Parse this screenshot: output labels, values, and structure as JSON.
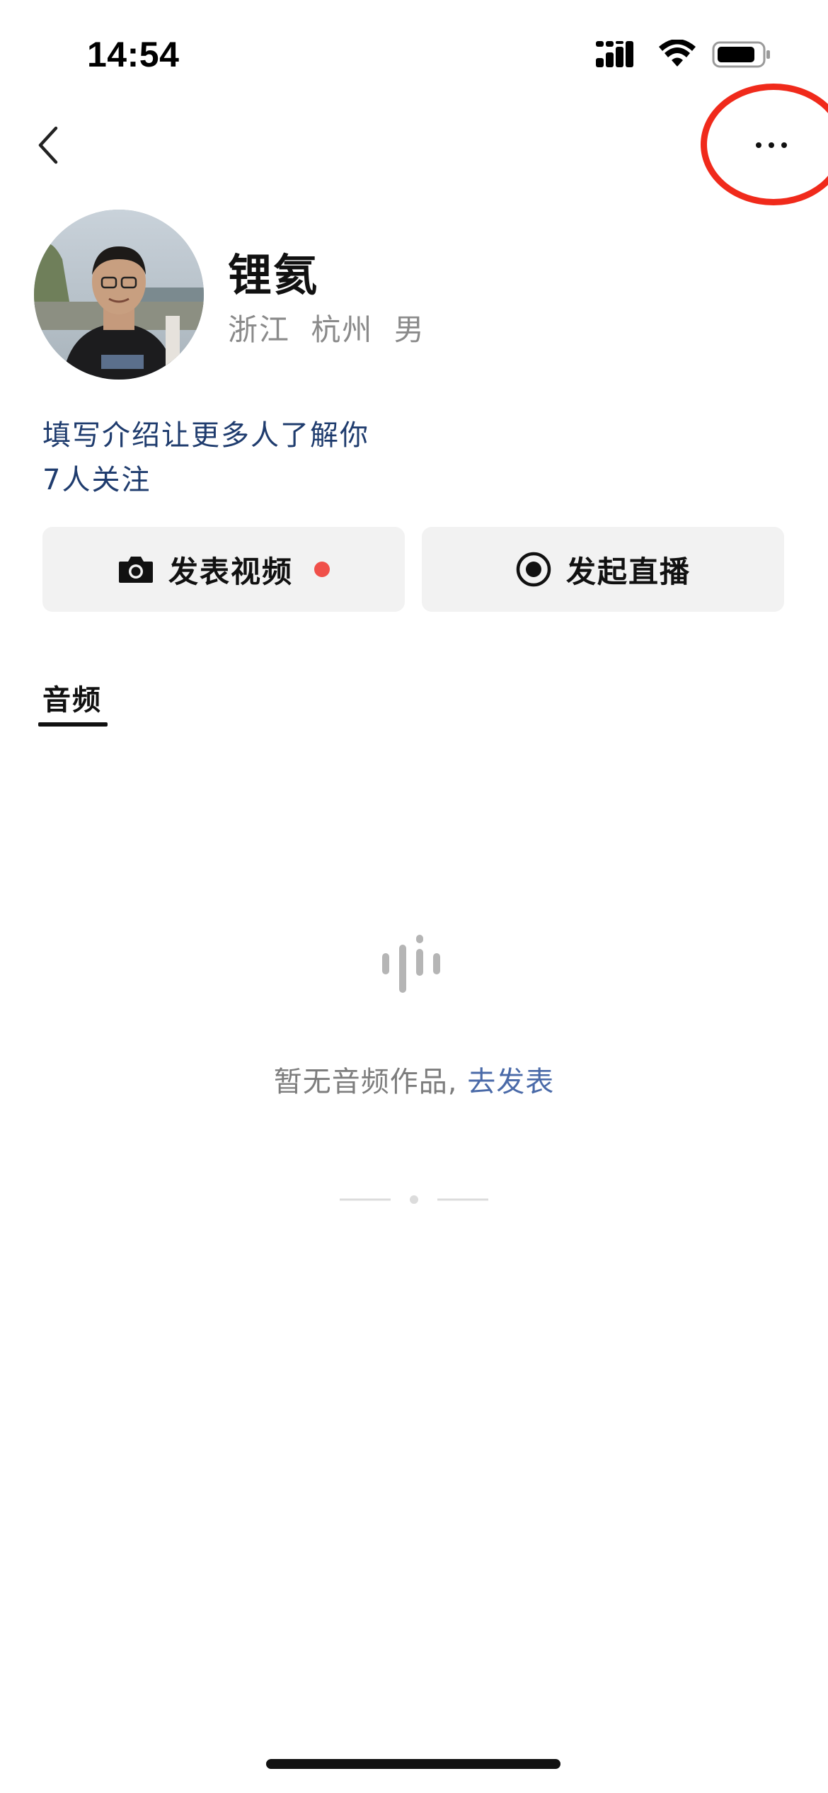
{
  "status_bar": {
    "time": "14:54",
    "signal_icon": "signal-icon",
    "wifi_icon": "wifi-icon",
    "battery_icon": "battery-icon"
  },
  "nav": {
    "back_icon": "chevron-left-icon",
    "more_icon": "more-horizontal-icon",
    "highlight_color": "#f02a1b"
  },
  "profile": {
    "name": "锂氦",
    "province": "浙江",
    "city": "杭州",
    "gender": "男",
    "intro_prompt": "填写介绍让更多人了解你",
    "followers": "7人关注"
  },
  "actions": {
    "post_video": {
      "label": "发表视频",
      "icon": "camera-icon",
      "badge_color": "#f0504a"
    },
    "start_live": {
      "label": "发起直播",
      "icon": "live-record-icon"
    }
  },
  "tabs": {
    "audio": "音频"
  },
  "empty_state": {
    "icon": "audio-wave-icon",
    "text": "暂无音频作品, ",
    "link": "去发表"
  },
  "colors": {
    "link_blue": "#1f3c6e",
    "accent_link": "#4a6aa8",
    "button_bg": "#f2f2f2"
  }
}
